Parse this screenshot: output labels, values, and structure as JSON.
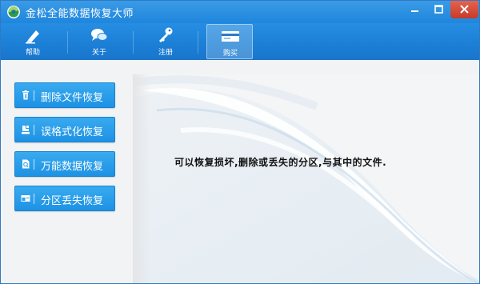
{
  "window": {
    "title": "金松全能数据恢复大师"
  },
  "toolbar": {
    "items": [
      {
        "label": "帮助",
        "icon": "help-marker-icon",
        "active": false
      },
      {
        "label": "关于",
        "icon": "chat-bubbles-icon",
        "active": false
      },
      {
        "label": "注册",
        "icon": "key-icon",
        "active": false
      },
      {
        "label": "购买",
        "icon": "card-icon",
        "active": true
      }
    ]
  },
  "sidebar": {
    "buttons": [
      {
        "label": "删除文件恢复",
        "icon": "trash-icon"
      },
      {
        "label": "误格式化恢复",
        "icon": "disk-icon"
      },
      {
        "label": "万能数据恢复",
        "icon": "document-icon"
      },
      {
        "label": "分区丢失恢复",
        "icon": "partition-icon"
      }
    ]
  },
  "main": {
    "description": "可以恢复损坏,删除或丢失的分区,与其中的文件."
  },
  "colors": {
    "titlebar": "#2a8fe2",
    "toolbar": "#1f84da",
    "button": "#2a9fea",
    "close": "#d84a37"
  }
}
